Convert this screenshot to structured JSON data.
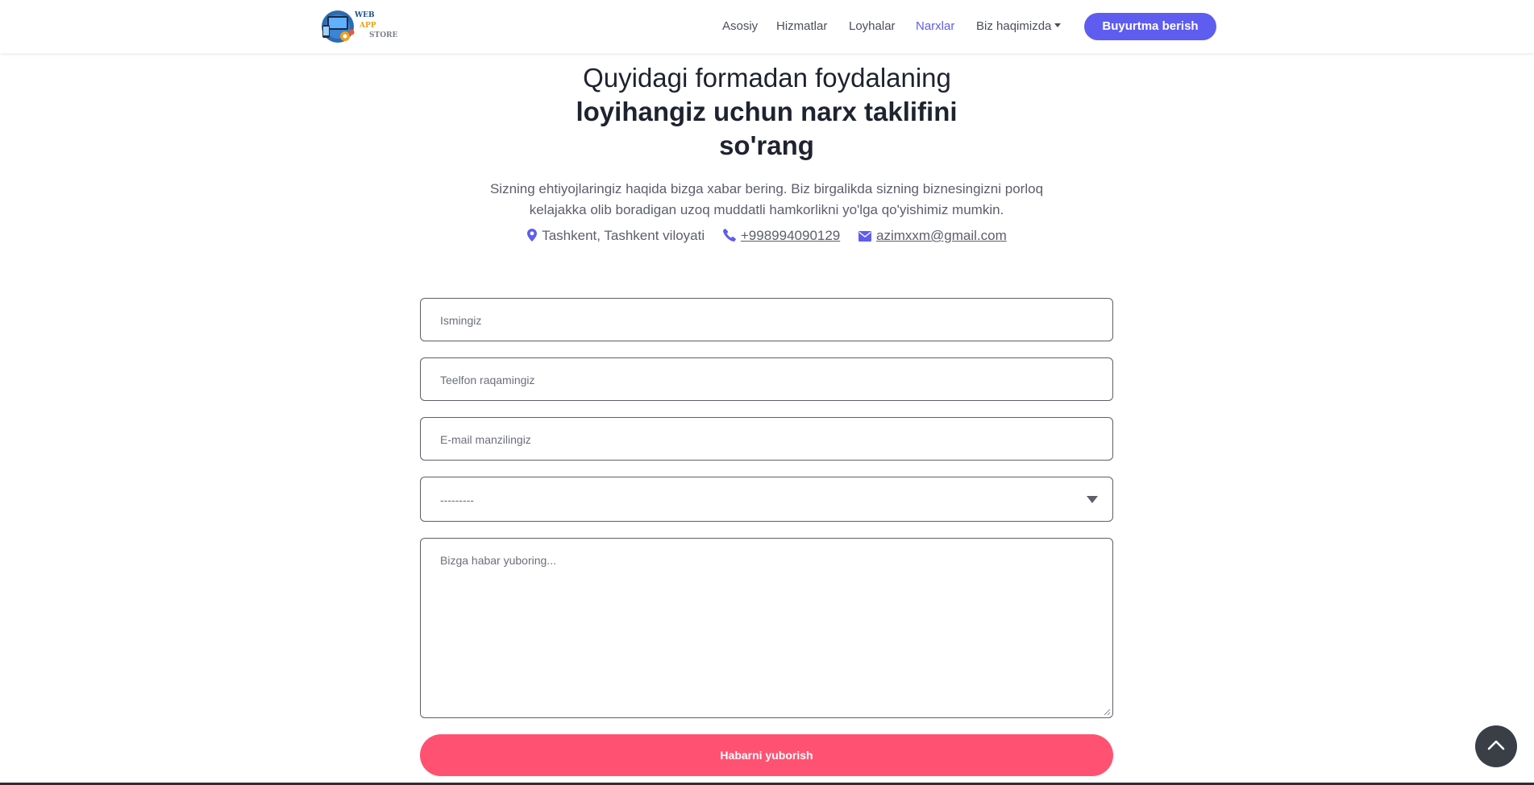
{
  "nav": {
    "logo": {
      "line1": "WEB",
      "line2": "APP",
      "line3": "STORE"
    },
    "links": [
      "Asosiy",
      "Hizmatlar",
      "Loyhalar",
      "Narxlar",
      "Biz haqimizda"
    ],
    "active_link": "Narxlar",
    "order_button": "Buyurtma berish"
  },
  "hero": {
    "title_line1": "Quyidagi formadan foydalaning",
    "title_line2": "loyihangiz uchun narx taklifini so'rang",
    "description": "Sizning ehtiyojlaringiz haqida bizga xabar bering. Biz birgalikda sizning biznesingizni porloq kelajakka olib boradigan uzoq muddatli hamkorlikni yo'lga qo'yishimiz mumkin.",
    "location": "Tashkent, Tashkent viloyati",
    "phone": "+998994090129",
    "email": "azimxxm@gmail.com"
  },
  "form": {
    "name_placeholder": "Ismingiz",
    "phone_placeholder": "Teelfon raqamingiz",
    "email_placeholder": "E-mail manzilingiz",
    "select_value": "---------",
    "message_placeholder": "Bizga habar yuboring...",
    "submit_label": "Habarni yuborish"
  },
  "colors": {
    "accent": "#5f5cf0",
    "submit": "#ff5272",
    "scroll_button": "#3a3f47"
  },
  "icons": [
    "map-marker-icon",
    "phone-icon",
    "envelope-icon",
    "chevron-up-icon",
    "dropdown-caret-icon"
  ]
}
